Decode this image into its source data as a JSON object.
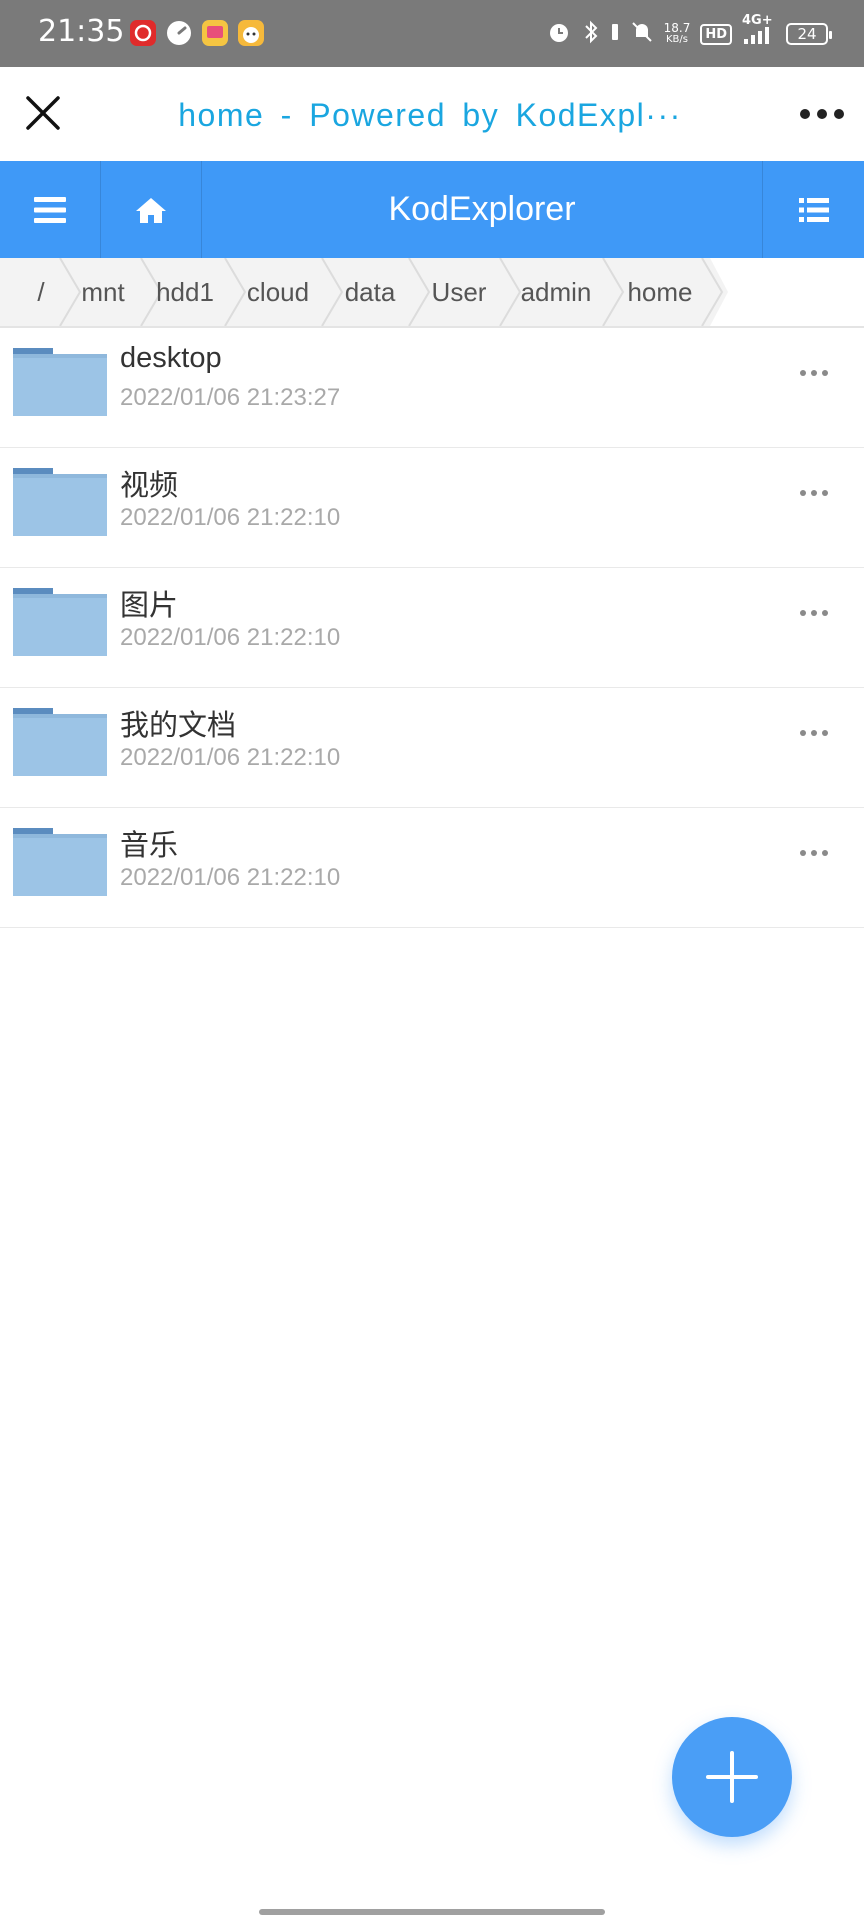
{
  "status_bar": {
    "time": "21:35",
    "net_speed": "18.7",
    "net_speed_unit": "KB/s",
    "hd_label": "HD",
    "network_label": "4G+",
    "battery": "24",
    "app_icons": [
      "netease-music-icon",
      "speedometer-icon",
      "gift-app-icon",
      "face-app-icon"
    ],
    "indicator_icons": [
      "alarm-icon",
      "bluetooth-icon",
      "vibrate-icon",
      "mute-icon",
      "signal-icon"
    ]
  },
  "title_bar": {
    "title": "home - Powered by KodExpl···"
  },
  "app_header": {
    "app_name": "KodExplorer",
    "color": "#3f99f7"
  },
  "breadcrumb": {
    "items": [
      "/",
      "mnt",
      "hdd1",
      "cloud",
      "data",
      "User",
      "admin",
      "home"
    ]
  },
  "files": [
    {
      "name": "desktop",
      "date": "2022/01/06 21:23:27"
    },
    {
      "name": "视频",
      "date": "2022/01/06 21:22:10"
    },
    {
      "name": "图片",
      "date": "2022/01/06 21:22:10"
    },
    {
      "name": "我的文档",
      "date": "2022/01/06 21:22:10"
    },
    {
      "name": "音乐",
      "date": "2022/01/06 21:22:10"
    }
  ],
  "colors": {
    "accent": "#3f99f7",
    "title_text": "#1aa6e0",
    "folder": "#9cc4e6",
    "folder_tab": "#5b8cbf",
    "fab": "#4a9ef6"
  }
}
